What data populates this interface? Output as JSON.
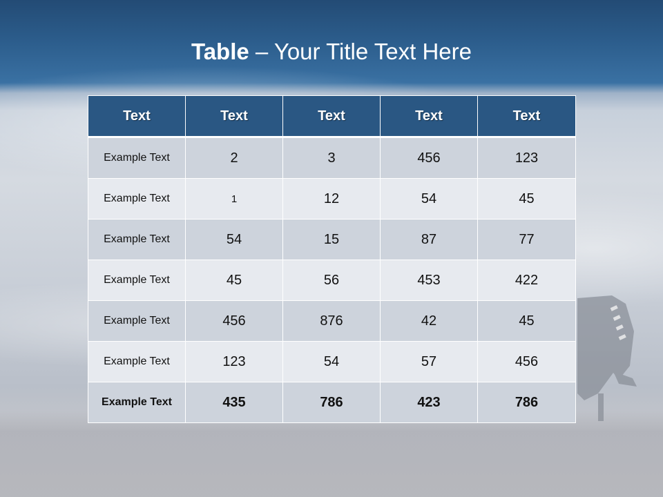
{
  "slide": {
    "title_bold": "Table",
    "title_rest": " – Your Title Text Here"
  },
  "table": {
    "headers": [
      "Text",
      "Text",
      "Text",
      "Text",
      "Text"
    ],
    "rows": [
      [
        "Example Text",
        "2",
        "3",
        "456",
        "123"
      ],
      [
        "Example Text",
        "1",
        "12",
        "54",
        "45"
      ],
      [
        "Example Text",
        "54",
        "15",
        "87",
        "77"
      ],
      [
        "Example Text",
        "45",
        "56",
        "453",
        "422"
      ],
      [
        "Example Text",
        "456",
        "876",
        "42",
        "45"
      ],
      [
        "Example Text",
        "123",
        "54",
        "57",
        "456"
      ],
      [
        "Example Text",
        "435",
        "786",
        "423",
        "786"
      ]
    ]
  },
  "colors": {
    "header_bg": "#2a5783",
    "row_odd_bg": "#cdd3dc",
    "row_even_bg": "#e7eaef",
    "title_text": "#ffffff"
  }
}
